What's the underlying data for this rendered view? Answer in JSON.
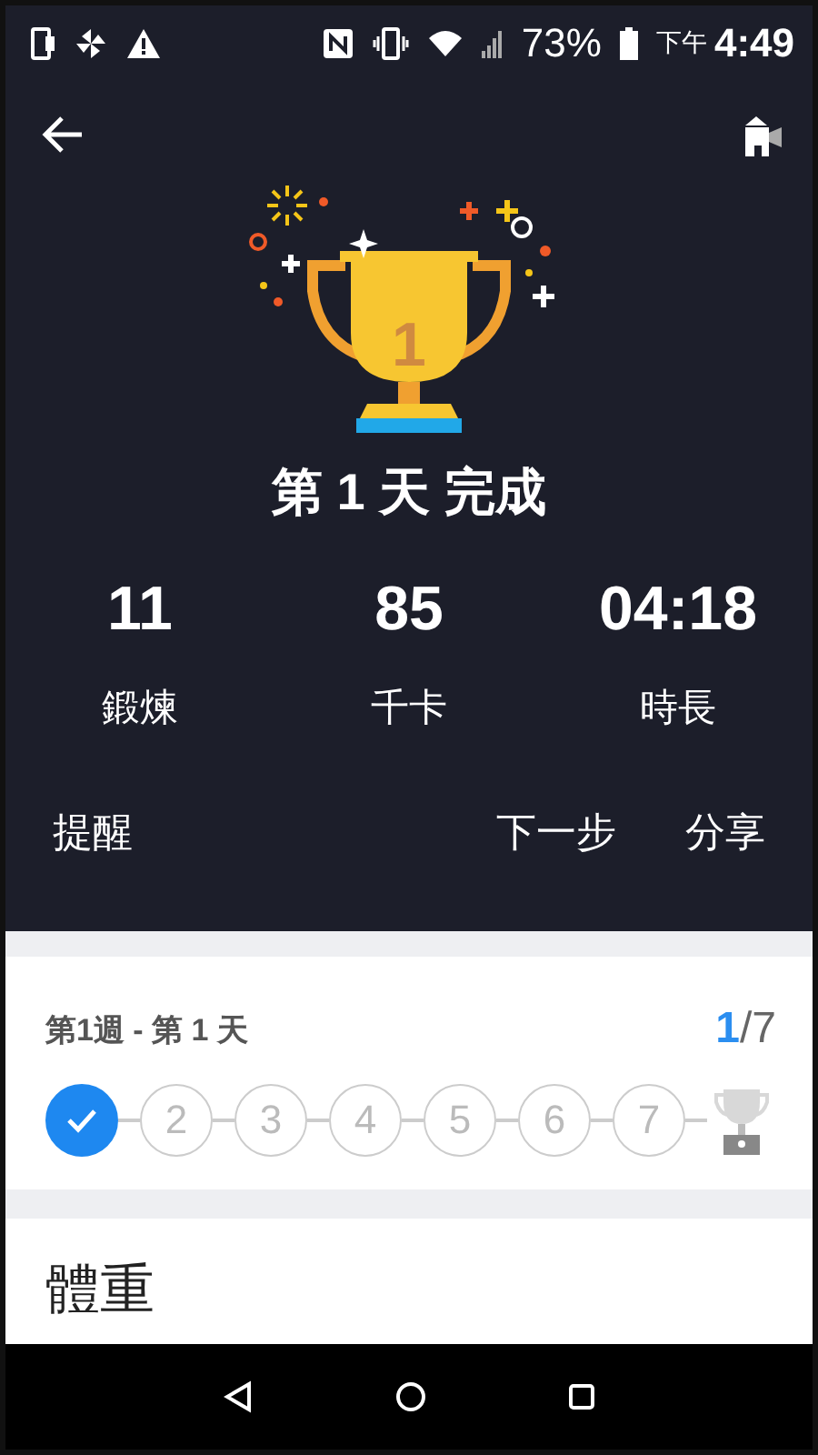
{
  "status_bar": {
    "battery": "73%",
    "period": "下午",
    "time": "4:49"
  },
  "result": {
    "trophy_rank": "1",
    "title": "第 1 天 完成",
    "stats": [
      {
        "value": "11",
        "label": "鍛煉"
      },
      {
        "value": "85",
        "label": "千卡"
      },
      {
        "value": "04:18",
        "label": "時長"
      }
    ],
    "actions": {
      "left": "提醒",
      "right": [
        "下一步",
        "分享"
      ]
    }
  },
  "week": {
    "title": "第1週 - 第 1 天",
    "progress_current": "1",
    "progress_total": "/7",
    "days": [
      {
        "done": true
      },
      {
        "label": "2",
        "done": false
      },
      {
        "label": "3",
        "done": false
      },
      {
        "label": "4",
        "done": false
      },
      {
        "label": "5",
        "done": false
      },
      {
        "label": "6",
        "done": false
      },
      {
        "label": "7",
        "done": false
      }
    ]
  },
  "weight": {
    "title": "體重"
  }
}
